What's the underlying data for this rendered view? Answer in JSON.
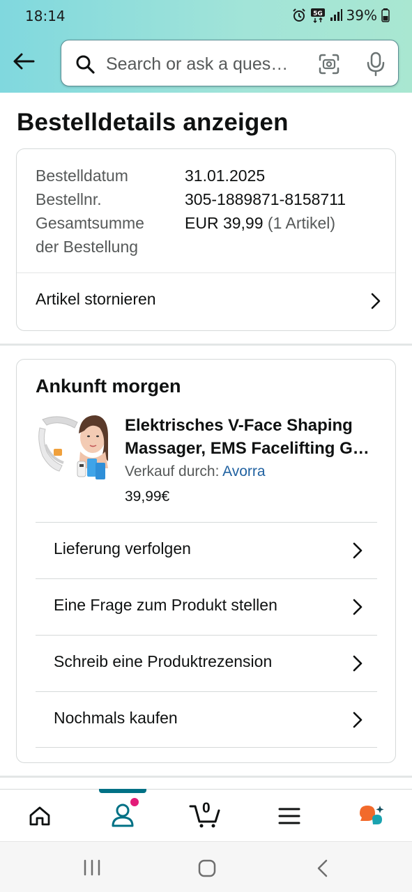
{
  "status_bar": {
    "time": "18:14",
    "battery": "39%",
    "network": "5G"
  },
  "search": {
    "placeholder": "Search or ask a ques…"
  },
  "page": {
    "title": "Bestelldetails anzeigen"
  },
  "order": {
    "date_label": "Bestelldatum",
    "date_value": "31.01.2025",
    "number_label": "Bestellnr.",
    "number_value": "305-1889871-8158711",
    "total_label_line1": "Gesamtsumme",
    "total_label_line2": "der Bestellung",
    "total_value": "EUR 39,99",
    "total_count": "(1 Artikel)",
    "cancel_label": "Artikel stornieren"
  },
  "shipment": {
    "heading": "Ankunft morgen",
    "product_title_line1": "Elektrisches V-Face Shaping",
    "product_title_line2": "Massager, EMS Facelifting G…",
    "seller_prefix": "Verkauf durch:",
    "seller_name": "Avorra",
    "price": "39,99€",
    "actions": [
      {
        "label": "Lieferung verfolgen"
      },
      {
        "label": "Eine Frage zum Produkt stellen"
      },
      {
        "label": "Schreib eine Produktrezension"
      },
      {
        "label": "Nochmals kaufen"
      }
    ]
  },
  "bottom_nav": {
    "items": [
      {
        "icon": "home-icon"
      },
      {
        "icon": "account-icon"
      },
      {
        "icon": "cart-icon",
        "count": "0"
      },
      {
        "icon": "menu-icon"
      },
      {
        "icon": "rufus-chat-icon"
      }
    ],
    "active_index": 1,
    "accent": "#007185",
    "notification_dot": "#e31c79"
  },
  "colors": {
    "header_gradient_start": "#80d8de",
    "header_gradient_end": "#a9e7d1",
    "link": "#2162a1"
  }
}
